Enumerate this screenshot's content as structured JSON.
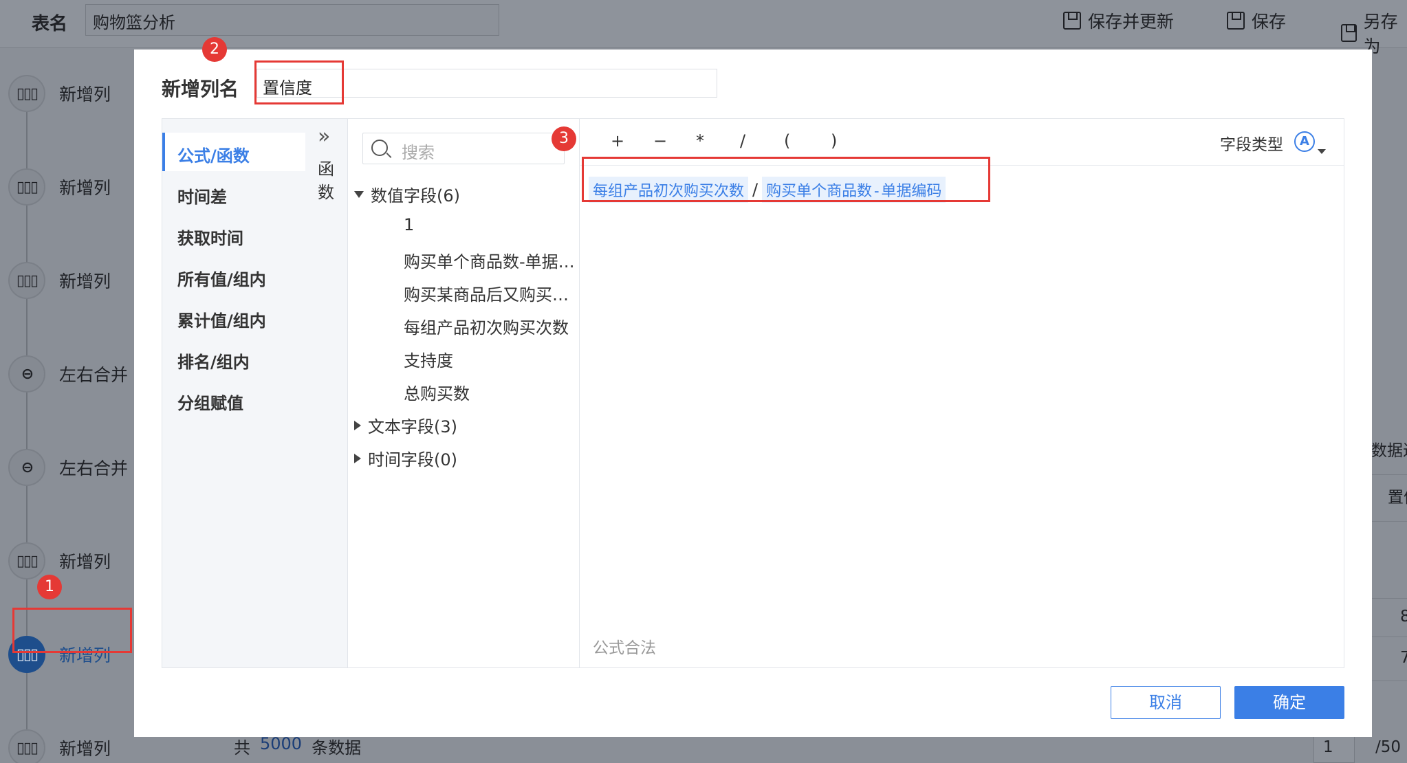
{
  "topbar": {
    "table_label": "表名",
    "table_name": "购物篮分析",
    "save_update": "保存并更新",
    "save": "保存",
    "save_as": "另存为"
  },
  "steps": [
    {
      "label": "新增列",
      "icon": "column-icon"
    },
    {
      "label": "新增列",
      "icon": "column-icon"
    },
    {
      "label": "新增列",
      "icon": "column-icon"
    },
    {
      "label": "左右合并",
      "icon": "merge-icon"
    },
    {
      "label": "左右合并",
      "icon": "merge-icon"
    },
    {
      "label": "新增列",
      "icon": "column-icon"
    },
    {
      "label": "新增列",
      "icon": "column-icon",
      "active": true
    },
    {
      "label": "新增列",
      "icon": "column-icon"
    }
  ],
  "dialog": {
    "title": "新增列名",
    "column_name": "置信度",
    "categories": [
      "公式/函数",
      "时间差",
      "获取时间",
      "所有值/组内",
      "累计值/组内",
      "排名/组内",
      "分组赋值"
    ],
    "function_tab": "函数",
    "search_placeholder": "搜索",
    "field_groups": [
      {
        "label": "数值字段(6)",
        "expanded": true,
        "items": [
          "1",
          "购买单个商品数-单据编码",
          "购买某商品后又购买其他商品数",
          "每组产品初次购买次数",
          "支持度",
          "总购买数"
        ]
      },
      {
        "label": "文本字段(3)",
        "expanded": false
      },
      {
        "label": "时间字段(0)",
        "expanded": false
      }
    ],
    "operators": [
      "+",
      "−",
      "*",
      "/",
      "(",
      ")"
    ],
    "field_type_label": "字段类型",
    "field_type_icon": "A",
    "formula": {
      "left": "每组产品初次购买次数",
      "operator": "/",
      "right": "购买单个商品数-单据编码"
    },
    "validation": "公式合法",
    "cancel": "取消",
    "ok": "确定"
  },
  "background_right": {
    "t1": "数据进",
    "t2": "置信",
    "t3": "8",
    "t4": "7"
  },
  "footer": {
    "prefix": "共",
    "count": "5000",
    "suffix": "条数据",
    "page": "1",
    "total": "/50"
  },
  "annotations": [
    "1",
    "2",
    "3"
  ],
  "colors": {
    "accent": "#3b7fe6",
    "annotation": "#e53935",
    "overlay": "#8a8f97"
  }
}
